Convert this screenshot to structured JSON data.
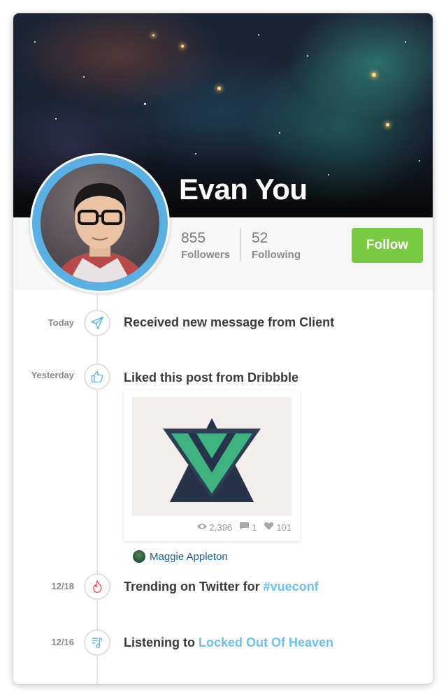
{
  "profile": {
    "name": "Evan You",
    "followers_count": "855",
    "followers_label": "Followers",
    "following_count": "52",
    "following_label": "Following",
    "follow_label": "Follow"
  },
  "colors": {
    "accent": "#6cc0ef",
    "follow": "#7ac943",
    "avatar_ring": "#5aafe3",
    "author_link": "#1c5f95"
  },
  "timeline": [
    {
      "date": "Today",
      "icon": "paper-plane-icon",
      "text": "Received new message from Client",
      "link": ""
    },
    {
      "date": "Yesterday",
      "icon": "thumbs-up-icon",
      "text": "Liked this post from Dribbble",
      "link": ""
    },
    {
      "date": "12/18",
      "icon": "flame-icon",
      "text": "Trending on Twitter for ",
      "link": "#vueconf"
    },
    {
      "date": "12/16",
      "icon": "music-list-icon",
      "text": "Listening to ",
      "link": "Locked Out Of Heaven"
    }
  ],
  "shot": {
    "views": "2,396",
    "comments": "1",
    "likes": "101",
    "author": "Maggie Appleton"
  }
}
